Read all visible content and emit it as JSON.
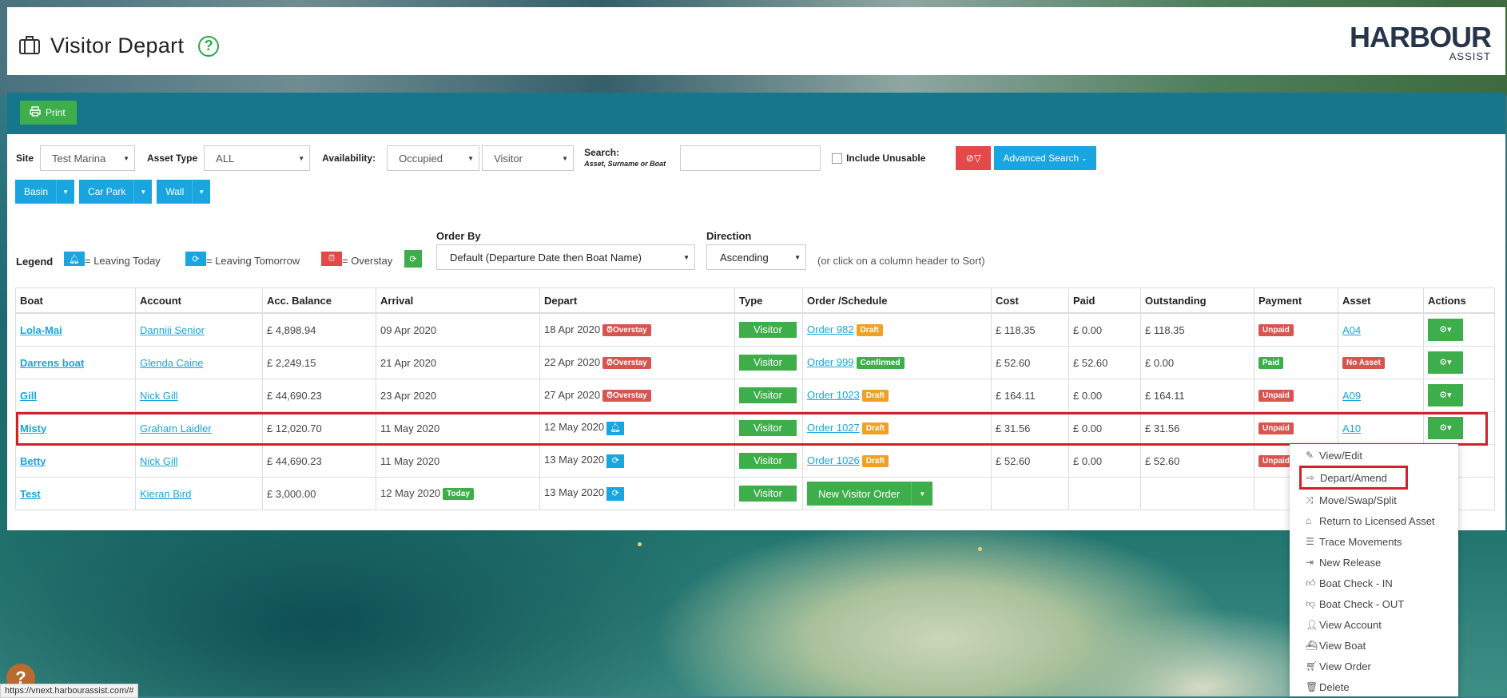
{
  "page": {
    "title": "Visitor Depart"
  },
  "logo": {
    "line1": "HARBOUR",
    "line2": "ASSIST"
  },
  "toolbar": {
    "print_label": "Print"
  },
  "filters": {
    "site_label": "Site",
    "site_value": "Test Marina",
    "asset_type_label": "Asset Type",
    "asset_type_value": "ALL",
    "availability_label": "Availability:",
    "availability_value": "Occupied",
    "visitor_value": "Visitor",
    "search_label": "Search:",
    "search_hint": "Asset, Surname or Boat",
    "search_value": "",
    "include_unusable_label": "Include Unusable",
    "advanced_search_label": "Advanced Search"
  },
  "split_buttons": [
    {
      "label": "Basin"
    },
    {
      "label": "Car Park"
    },
    {
      "label": "Wall"
    }
  ],
  "legend": {
    "label": "Legend",
    "leaving_today": "= Leaving Today",
    "leaving_tomorrow": "= Leaving Tomorrow",
    "overstay": "= Overstay"
  },
  "order_by": {
    "label": "Order By",
    "value": "Default (Departure Date then Boat Name)"
  },
  "direction": {
    "label": "Direction",
    "value": "Ascending"
  },
  "sort_hint": "(or click on a column header to Sort)",
  "table": {
    "headers": [
      "Boat",
      "Account",
      "Acc. Balance",
      "Arrival",
      "Depart",
      "Type",
      "Order /Schedule",
      "Cost",
      "Paid",
      "Outstanding",
      "Payment",
      "Asset",
      "Actions"
    ],
    "rows": [
      {
        "boat": "Lola-Mai",
        "account": "Danniii Senior",
        "balance": "£ 4,898.94",
        "arrival": "09 Apr 2020",
        "depart": "18 Apr 2020",
        "depart_badge": "Overstay",
        "type": "Visitor",
        "order": "Order 982",
        "order_badge": "Draft",
        "cost": "£ 118.35",
        "paid": "£ 0.00",
        "outstanding": "£ 118.35",
        "payment": "Unpaid",
        "asset": "A04"
      },
      {
        "boat": "Darrens boat",
        "account": "Glenda Caine",
        "balance": "£ 2,249.15",
        "arrival": "21 Apr 2020",
        "depart": "22 Apr 2020",
        "depart_badge": "Overstay",
        "type": "Visitor",
        "order": "Order 999",
        "order_badge": "Confirmed",
        "cost": "£ 52.60",
        "paid": "£ 52.60",
        "outstanding": "£ 0.00",
        "payment": "Paid",
        "asset": "No Asset"
      },
      {
        "boat": "Gill",
        "account": "Nick Gill",
        "balance": "£ 44,690.23",
        "arrival": "23 Apr 2020",
        "depart": "27 Apr 2020",
        "depart_badge": "Overstay",
        "type": "Visitor",
        "order": "Order 1023",
        "order_badge": "Draft",
        "cost": "£ 164.11",
        "paid": "£ 0.00",
        "outstanding": "£ 164.11",
        "payment": "Unpaid",
        "asset": "A09"
      },
      {
        "boat": "Misty",
        "account": "Graham Laidler",
        "balance": "£ 12,020.70",
        "arrival": "11 May 2020",
        "depart": "12 May 2020",
        "type": "Visitor",
        "order": "Order 1027",
        "order_badge": "Draft",
        "cost": "£ 31.56",
        "paid": "£ 0.00",
        "outstanding": "£ 31.56",
        "payment": "Unpaid",
        "asset": "A10"
      },
      {
        "boat": "Betty",
        "account": "Nick Gill",
        "balance": "£ 44,690.23",
        "arrival": "11 May 2020",
        "depart": "13 May 2020",
        "type": "Visitor",
        "order": "Order 1026",
        "order_badge": "Draft",
        "cost": "£ 52.60",
        "paid": "£ 0.00",
        "outstanding": "£ 52.60",
        "payment": "Unpaid"
      },
      {
        "boat": "Test",
        "account": "Kieran Bird",
        "balance": "£ 3,000.00",
        "arrival": "12 May 2020",
        "arrival_badge": "Today",
        "depart": "13 May 2020",
        "type": "Visitor",
        "new_order": "New Visitor Order"
      }
    ]
  },
  "actions_menu": {
    "items": [
      {
        "label": "View/Edit",
        "icon": "edit-icon"
      },
      {
        "label": "Depart/Amend",
        "icon": "depart-icon"
      },
      {
        "label": "Move/Swap/Split",
        "icon": "shuffle-icon"
      },
      {
        "label": "Return to Licensed Asset",
        "icon": "home-icon"
      },
      {
        "label": "Trace Movements",
        "icon": "list-icon"
      },
      {
        "label": "New Release",
        "icon": "release-icon"
      },
      {
        "label": "Boat Check - IN",
        "icon": "thumbs-up-icon"
      },
      {
        "label": "Boat Check - OUT",
        "icon": "thumbs-down-icon"
      },
      {
        "label": "View Account",
        "icon": "user-icon"
      },
      {
        "label": "View Boat",
        "icon": "ship-icon"
      },
      {
        "label": "View Order",
        "icon": "cart-icon"
      },
      {
        "label": "Delete",
        "icon": "trash-icon"
      }
    ]
  },
  "status_bar": {
    "url": "https://vnext.harbourassist.com/#"
  },
  "colors": {
    "primary_green": "#3dae4a",
    "primary_blue": "#18a5e0",
    "header_teal": "#17758c",
    "danger_red": "#e34949",
    "draft_orange": "#f0a024"
  }
}
